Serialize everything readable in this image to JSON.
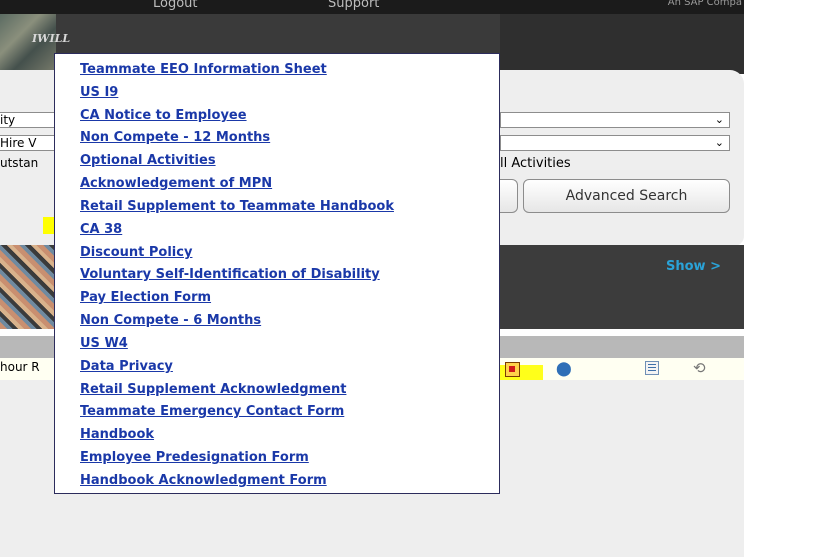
{
  "topbar": {
    "logout": "Logout",
    "support": "Support",
    "company": "An SAP Compa"
  },
  "banner": {
    "photo_text": "IWILL"
  },
  "search": {
    "select1_value": "ity",
    "select2_value": "Hire V",
    "outstanding_label": "utstan",
    "all_activities_label": "ll Activities",
    "advanced_search_label": "Advanced Search"
  },
  "show_link": "Show >",
  "toolbar": {
    "row_label": "hour R"
  },
  "menu": {
    "items": [
      "Teammate EEO Information Sheet",
      "US I9",
      "CA Notice to Employee",
      "Non Compete - 12 Months",
      "Optional Activities",
      "Acknowledgement of MPN",
      "Retail Supplement to Teammate Handbook",
      "CA 38",
      "Discount Policy",
      "Voluntary Self-Identification of Disability",
      "Pay Election Form",
      "Non Compete - 6 Months",
      "US W4",
      "Data Privacy",
      "Retail Supplement Acknowledgment",
      "Teammate Emergency Contact Form",
      "Handbook",
      "Employee Predesignation Form",
      "Handbook Acknowledgment Form"
    ]
  },
  "colors": {
    "link": "#1a38a8",
    "highlight": "#ffff00",
    "show_link": "#2aa3d8"
  },
  "icons": [
    "pdf-icon",
    "search-icon",
    "list-icon",
    "refresh-icon"
  ]
}
